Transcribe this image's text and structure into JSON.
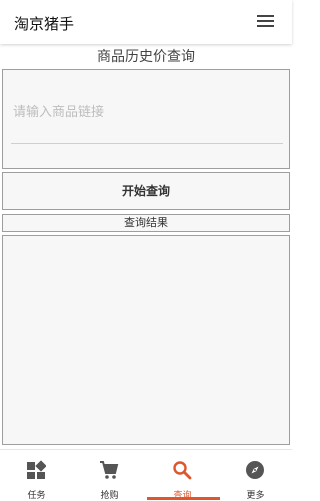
{
  "app": {
    "title": "淘京猪手"
  },
  "page": {
    "title": "商品历史价查询"
  },
  "search": {
    "placeholder": "请输入商品链接",
    "value": ""
  },
  "buttons": {
    "query_label": "开始查询"
  },
  "results": {
    "label": "查询结果"
  },
  "nav": {
    "items": [
      {
        "label": "任务",
        "icon": "dashboard-icon"
      },
      {
        "label": "抢购",
        "icon": "cart-icon"
      },
      {
        "label": "查询",
        "icon": "search-icon",
        "active": true
      },
      {
        "label": "更多",
        "icon": "compass-icon"
      }
    ],
    "active_color": "#e0552b",
    "inactive_color": "#555555"
  }
}
